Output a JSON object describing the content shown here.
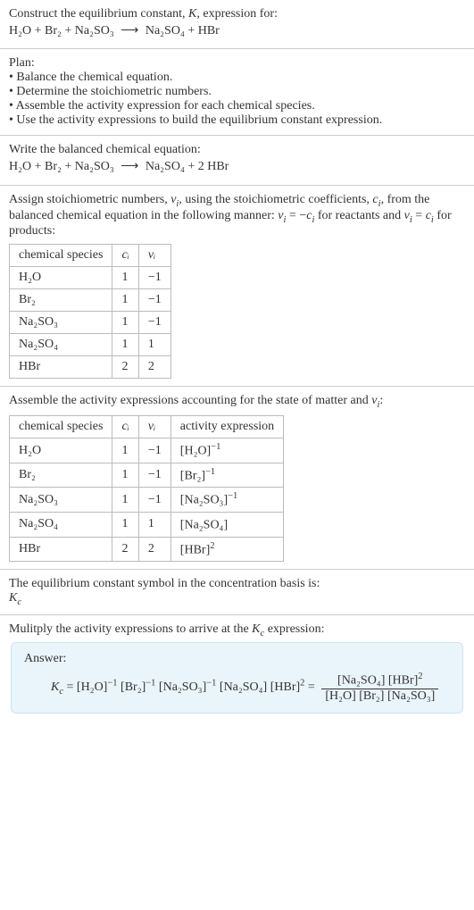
{
  "header": {
    "prompt": "Construct the equilibrium constant, ",
    "K": "K",
    "prompt2": ", expression for:",
    "equation_lhs": "H₂O + Br₂ + Na₂SO₃",
    "equation_arrow": "⟶",
    "equation_rhs": "Na₂SO₄ + HBr"
  },
  "plan": {
    "title": "Plan:",
    "items": [
      "• Balance the chemical equation.",
      "• Determine the stoichiometric numbers.",
      "• Assemble the activity expression for each chemical species.",
      "• Use the activity expressions to build the equilibrium constant expression."
    ]
  },
  "balanced": {
    "title": "Write the balanced chemical equation:",
    "lhs": "H₂O + Br₂ + Na₂SO₃",
    "arrow": "⟶",
    "rhs": "Na₂SO₄ + 2 HBr"
  },
  "stoich": {
    "intro1": "Assign stoichiometric numbers, ",
    "nu": "ν",
    "sub_i": "i",
    "intro2": ", using the stoichiometric coefficients, ",
    "c": "c",
    "intro3": ", from the balanced chemical equation in the following manner: ",
    "rel1_lhs": "ν",
    "rel1_eq": " = −",
    "rel1_rhs": "c",
    "rel1_tail": " for reactants and ",
    "rel2_lhs": "ν",
    "rel2_eq": " = ",
    "rel2_rhs": "c",
    "rel2_tail": " for products:",
    "headers": [
      "chemical species",
      "cᵢ",
      "νᵢ"
    ],
    "rows": [
      {
        "species": "H₂O",
        "c": "1",
        "nu": "−1"
      },
      {
        "species": "Br₂",
        "c": "1",
        "nu": "−1"
      },
      {
        "species": "Na₂SO₃",
        "c": "1",
        "nu": "−1"
      },
      {
        "species": "Na₂SO₄",
        "c": "1",
        "nu": "1"
      },
      {
        "species": "HBr",
        "c": "2",
        "nu": "2"
      }
    ]
  },
  "activity": {
    "intro1": "Assemble the activity expressions accounting for the state of matter and ",
    "intro2": ":",
    "headers": [
      "chemical species",
      "cᵢ",
      "νᵢ",
      "activity expression"
    ],
    "rows": [
      {
        "species": "H₂O",
        "c": "1",
        "nu": "−1",
        "expr_base": "[H₂O]",
        "expr_pow": "−1"
      },
      {
        "species": "Br₂",
        "c": "1",
        "nu": "−1",
        "expr_base": "[Br₂]",
        "expr_pow": "−1"
      },
      {
        "species": "Na₂SO₃",
        "c": "1",
        "nu": "−1",
        "expr_base": "[Na₂SO₃]",
        "expr_pow": "−1"
      },
      {
        "species": "Na₂SO₄",
        "c": "1",
        "nu": "1",
        "expr_base": "[Na₂SO₄]",
        "expr_pow": ""
      },
      {
        "species": "HBr",
        "c": "2",
        "nu": "2",
        "expr_base": "[HBr]",
        "expr_pow": "2"
      }
    ]
  },
  "symbol": {
    "line1": "The equilibrium constant symbol in the concentration basis is:",
    "K": "K",
    "sub": "c"
  },
  "multiply": {
    "line": "Mulitply the activity expressions to arrive at the ",
    "K": "K",
    "sub": "c",
    "line2": " expression:"
  },
  "answer": {
    "label": "Answer:",
    "Kc_K": "K",
    "Kc_sub": "c",
    "eq": " = ",
    "t1": "[H₂O]",
    "p1": "−1",
    "t2": "[Br₂]",
    "p2": "−1",
    "t3": "[Na₂SO₃]",
    "p3": "−1",
    "t4": "[Na₂SO₄]",
    "t5": "[HBr]",
    "p5": "2",
    "eq2": " = ",
    "num1": "[Na₂SO₄]",
    "num2": "[HBr]",
    "num2p": "2",
    "den1": "[H₂O]",
    "den2": "[Br₂]",
    "den3": "[Na₂SO₃]"
  }
}
